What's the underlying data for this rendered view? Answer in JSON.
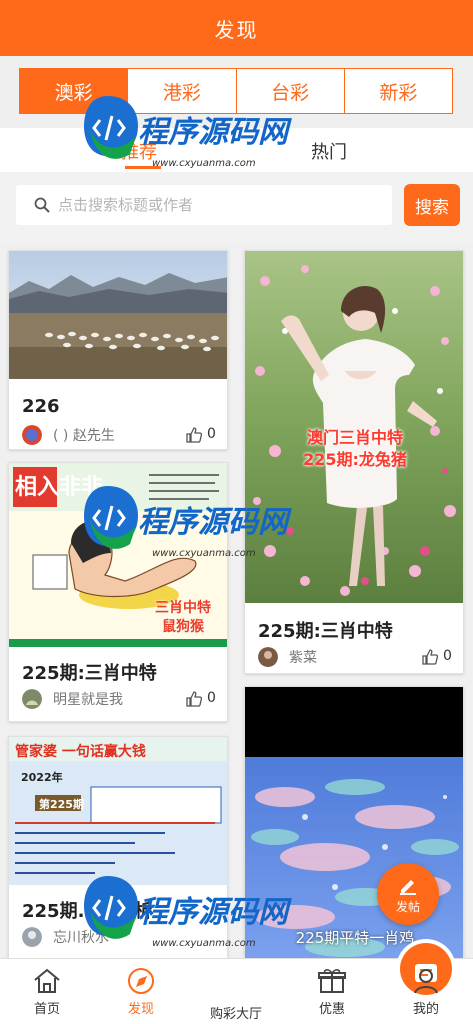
{
  "header": {
    "title": "发现"
  },
  "lottery_tabs": [
    "澳彩",
    "港彩",
    "台彩",
    "新彩"
  ],
  "sub_tabs": [
    "推荐",
    "热门"
  ],
  "search": {
    "placeholder": "点击搜索标题或作者",
    "button_label": "搜索"
  },
  "posts": [
    {
      "title": "226",
      "author": "(  ) 赵先生",
      "likes": "0"
    },
    {
      "title": "225期:三肖中特",
      "author": "紫菜",
      "likes": "0",
      "image_caption": [
        "澳门三肖中特",
        "225期:龙兔猪"
      ]
    },
    {
      "title": "225期:三肖中特",
      "author": "明星就是我",
      "likes": "0",
      "image_caption": [
        "三肖中特",
        "鼠狗猴"
      ],
      "image_headline": "相入非非"
    },
    {
      "title": "225期...寂解析",
      "author": "忘川秋水",
      "likes": "",
      "image_headline": "管家婆 一句话赢大钱",
      "image_year": "2022年",
      "image_issue": "第225期"
    },
    {
      "title": "",
      "author": "",
      "likes": "",
      "image_caption": [
        "225期平特一肖鸡"
      ]
    }
  ],
  "fab": {
    "label": "发帖"
  },
  "watermark": {
    "text": "程序源码网",
    "url": "www.cxyuanma.com"
  },
  "bottom_nav": [
    {
      "label": "首页",
      "icon": "home-icon"
    },
    {
      "label": "发现",
      "icon": "discover-icon"
    },
    {
      "label": "购彩大厅",
      "icon": "lottery-hall-icon"
    },
    {
      "label": "优惠",
      "icon": "gift-icon"
    },
    {
      "label": "我的",
      "icon": "profile-icon"
    }
  ],
  "colors": {
    "accent": "#ff6a1a",
    "text": "#222222",
    "muted": "#777777"
  }
}
